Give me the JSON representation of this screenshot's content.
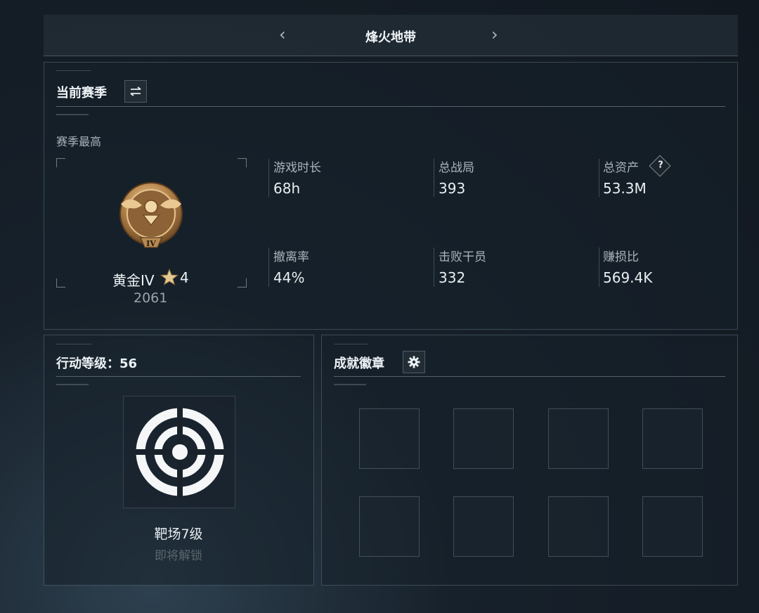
{
  "header": {
    "title": "烽火地带",
    "prev_icon": "chevron-left-icon",
    "next_icon": "chevron-right-icon"
  },
  "season": {
    "heading": "当前赛季",
    "switch_icon": "swap-icon",
    "best_label": "赛季最高",
    "rank_name": "黄金IV",
    "rank_stars": "4",
    "rank_points": "2061",
    "rank_icon": "eagle-medal-icon",
    "stats": [
      {
        "label": "游戏时长",
        "value": "68h"
      },
      {
        "label": "总战局",
        "value": "393"
      },
      {
        "label": "总资产",
        "value": "53.3M",
        "help_icon": "?"
      },
      {
        "label": "撤离率",
        "value": "44%"
      },
      {
        "label": "击败干员",
        "value": "332"
      },
      {
        "label": "赚损比",
        "value": "569.4K"
      }
    ]
  },
  "action_level": {
    "heading": "行动等级：56",
    "badge_icon": "target-reticle-icon",
    "badge_name": "靶场7级",
    "badge_status": "即将解锁"
  },
  "achievements": {
    "heading": "成就徽章",
    "settings_icon": "gear-icon",
    "slots": [
      "",
      "",
      "",
      "",
      "",
      "",
      "",
      ""
    ]
  },
  "colors": {
    "gold": "#c99a5a",
    "text": "#e9eef1",
    "muted": "#aab4ba"
  }
}
